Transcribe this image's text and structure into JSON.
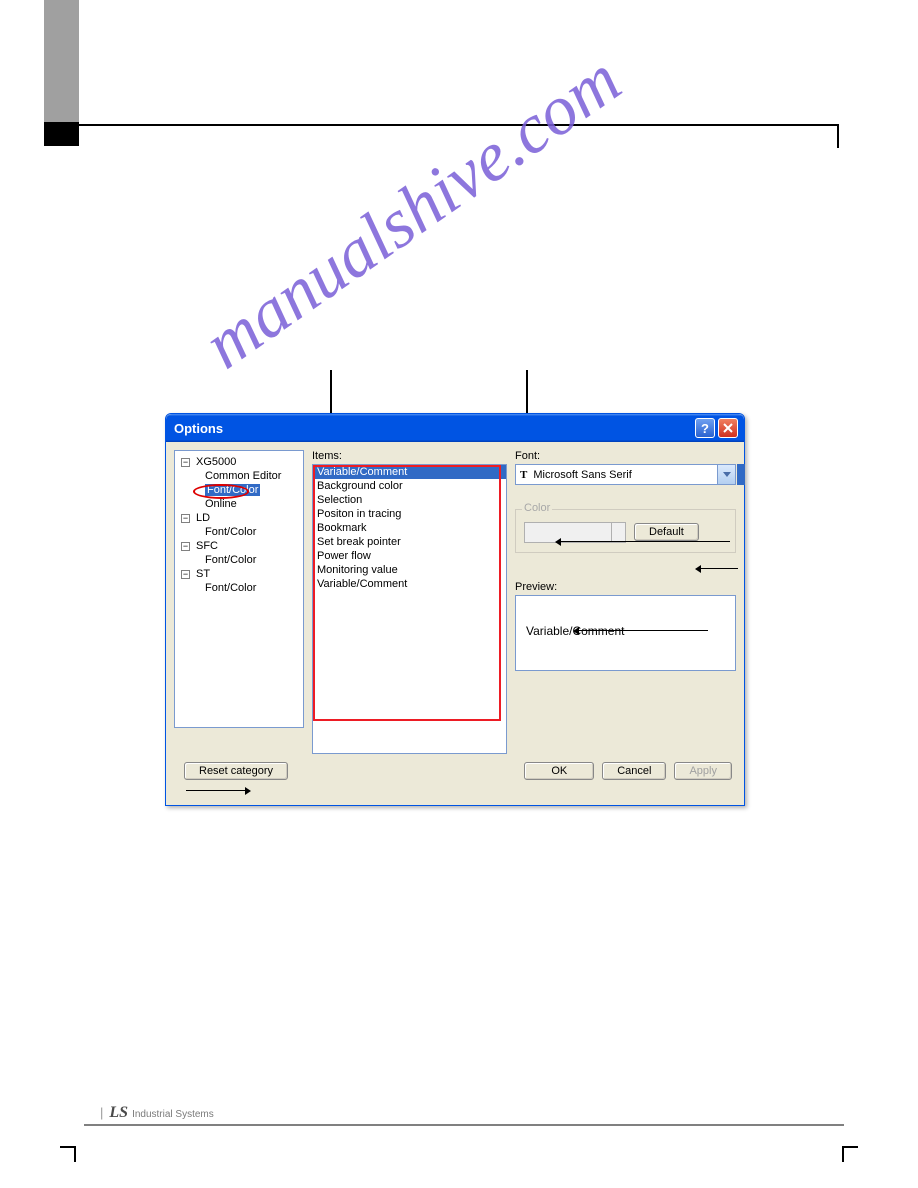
{
  "watermark": "manualshive.com",
  "dialog": {
    "title": "Options",
    "tree": {
      "root1": "XG5000",
      "root1_children": {
        "a": "Common Editor",
        "b": "Font/Color",
        "c": "Online"
      },
      "root2": "LD",
      "root2_children": {
        "a": "Font/Color"
      },
      "root3": "SFC",
      "root3_children": {
        "a": "Font/Color"
      },
      "root4": "ST",
      "root4_children": {
        "a": "Font/Color"
      }
    },
    "items_label": "Items:",
    "items": [
      "Variable/Comment",
      "Background color",
      "Selection",
      "Positon in tracing",
      "Bookmark",
      "Set break pointer",
      "Power flow",
      "Monitoring value",
      "Variable/Comment"
    ],
    "font_label": "Font:",
    "font_value": "Microsoft Sans Serif",
    "color_label": "Color",
    "default_button": "Default",
    "preview_label": "Preview:",
    "preview_value": "Variable/Comment",
    "reset_button": "Reset category",
    "ok_button": "OK",
    "cancel_button": "Cancel",
    "apply_button": "Apply"
  },
  "footer": {
    "ls": "LS",
    "sub": "Industrial Systems"
  }
}
